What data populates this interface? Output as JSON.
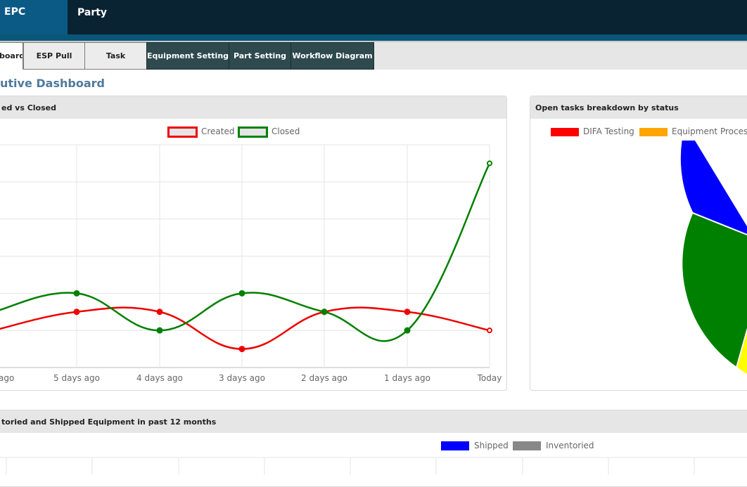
{
  "nav": {
    "brand": "EPC",
    "party": "Party"
  },
  "tabs": [
    {
      "label": "board"
    },
    {
      "label": "ESP Pull"
    },
    {
      "label": "Task"
    },
    {
      "label": "Equipment Setting"
    },
    {
      "label": "Part Setting"
    },
    {
      "label": "Workflow Diagram"
    }
  ],
  "page": {
    "title": "utive Dashboard"
  },
  "panels": {
    "created_closed": {
      "title": "ed vs Closed",
      "legend": [
        {
          "label": "Created",
          "color": "#ee0000"
        },
        {
          "label": "Closed",
          "color": "#008000"
        }
      ]
    },
    "open_tasks": {
      "title": "Open tasks breakdown by status",
      "legend": [
        {
          "label": "DIFA Testing",
          "color": "#ff0000"
        },
        {
          "label": "Equipment Processi",
          "color": "#ffa500"
        }
      ]
    },
    "shipped": {
      "title": "toried and Shipped Equipment in past 12 months",
      "legend": [
        {
          "label": "Shipped",
          "color": "#0000ff"
        },
        {
          "label": "Inventoried",
          "color": "#888888"
        }
      ]
    }
  },
  "chart_data": [
    {
      "type": "line",
      "title": "ed vs Closed",
      "categories": [
        "ago",
        "5 days ago",
        "4 days ago",
        "3 days ago",
        "2 days ago",
        "1 days ago",
        "Today"
      ],
      "series": [
        {
          "name": "Created",
          "color": "#ee0000",
          "values": [
            1,
            1.5,
            1.5,
            0.5,
            1.5,
            1.5,
            1
          ]
        },
        {
          "name": "Closed",
          "color": "#008000",
          "values": [
            1.5,
            2,
            1,
            2,
            1.5,
            1,
            5.5
          ]
        }
      ],
      "ylim": [
        0,
        6
      ],
      "grid": true,
      "legend": "top-center"
    },
    {
      "type": "pie",
      "title": "Open tasks breakdown by status",
      "legend_entries": [
        "DIFA Testing",
        "Equipment Processi"
      ],
      "visible_slice_colors": [
        "#0000ff",
        "#008000",
        "#ffff00"
      ]
    }
  ]
}
